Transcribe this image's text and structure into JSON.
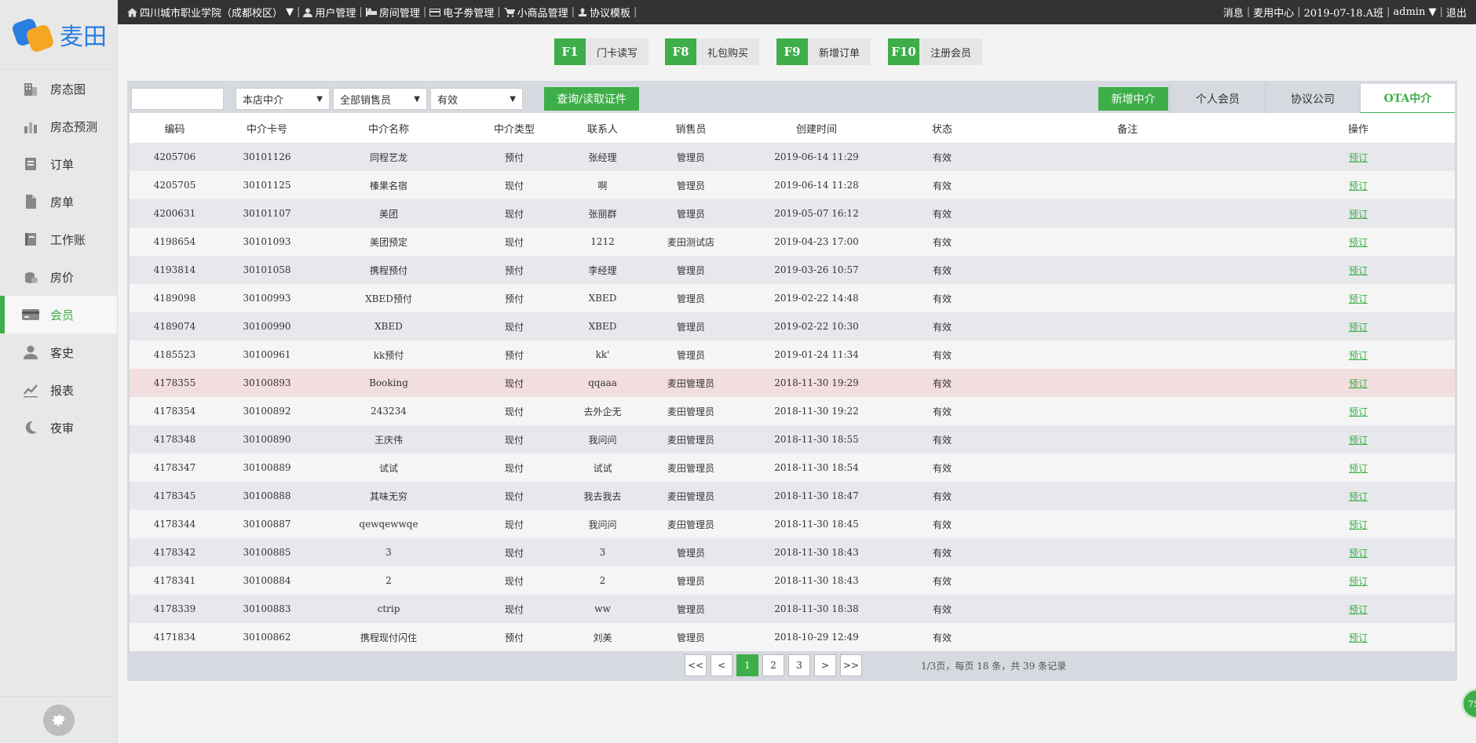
{
  "brand": {
    "logo_text": "麦田"
  },
  "sidebar": {
    "items": [
      {
        "label": "房态图",
        "icon": "building-icon",
        "active": false
      },
      {
        "label": "房态预测",
        "icon": "bar-chart-icon",
        "active": false
      },
      {
        "label": "订单",
        "icon": "order-icon",
        "active": false
      },
      {
        "label": "房单",
        "icon": "document-icon",
        "active": false
      },
      {
        "label": "工作账",
        "icon": "ledger-icon",
        "active": false
      },
      {
        "label": "房价",
        "icon": "coins-icon",
        "active": false
      },
      {
        "label": "会员",
        "icon": "member-card-icon",
        "active": true
      },
      {
        "label": "客史",
        "icon": "user-icon",
        "active": false
      },
      {
        "label": "报表",
        "icon": "report-chart-icon",
        "active": false
      },
      {
        "label": "夜审",
        "icon": "moon-icon",
        "active": false
      }
    ]
  },
  "topbar": {
    "hotel": "四川城市职业学院（成都校区）",
    "hotel_caret": "▼",
    "menu": [
      "用户管理",
      "房间管理",
      "电子劵管理",
      "小商品管理",
      "协议模板"
    ],
    "right": [
      "消息",
      "麦用中心",
      "2019-07-18.A班",
      "admin ▼",
      "退出"
    ]
  },
  "hotkeys": [
    {
      "key": "F1",
      "label": "门卡读写"
    },
    {
      "key": "F8",
      "label": "礼包购买"
    },
    {
      "key": "F9",
      "label": "新增订单"
    },
    {
      "key": "F10",
      "label": "注册会员"
    }
  ],
  "filters": {
    "search_value": "",
    "store_select": "本店中介",
    "sales_select": "全部销售员",
    "status_select": "有效",
    "query_button": "查询/读取证件"
  },
  "tabs": {
    "add_button": "新增中介",
    "items": [
      {
        "label": "个人会员",
        "active": false
      },
      {
        "label": "协议公司",
        "active": false
      },
      {
        "label": "OTA中介",
        "active": true
      }
    ]
  },
  "table": {
    "columns": [
      "编码",
      "中介卡号",
      "中介名称",
      "中介类型",
      "联系人",
      "销售员",
      "创建时间",
      "状态",
      "备注",
      "操作"
    ],
    "action_label": "预订",
    "rows": [
      [
        "4205706",
        "30101126",
        "同程艺龙",
        "预付",
        "张经理",
        "管理员",
        "2019-06-14 11:29",
        "有效",
        ""
      ],
      [
        "4205705",
        "30101125",
        "榛果名宿",
        "现付",
        "啊",
        "管理员",
        "2019-06-14 11:28",
        "有效",
        ""
      ],
      [
        "4200631",
        "30101107",
        "美团",
        "现付",
        "张丽群",
        "管理员",
        "2019-05-07 16:12",
        "有效",
        ""
      ],
      [
        "4198654",
        "30101093",
        "美团预定",
        "现付",
        "1212",
        "麦田测试店",
        "2019-04-23 17:00",
        "有效",
        ""
      ],
      [
        "4193814",
        "30101058",
        "携程预付",
        "预付",
        "李经理",
        "管理员",
        "2019-03-26 10:57",
        "有效",
        ""
      ],
      [
        "4189098",
        "30100993",
        "XBED预付",
        "预付",
        "XBED",
        "管理员",
        "2019-02-22 14:48",
        "有效",
        ""
      ],
      [
        "4189074",
        "30100990",
        "XBED",
        "现付",
        "XBED",
        "管理员",
        "2019-02-22 10:30",
        "有效",
        ""
      ],
      [
        "4185523",
        "30100961",
        "kk预付",
        "预付",
        "kk'",
        "管理员",
        "2019-01-24 11:34",
        "有效",
        ""
      ],
      [
        "4178355",
        "30100893",
        "Booking",
        "现付",
        "qqaaa",
        "麦田管理员",
        "2018-11-30 19:29",
        "有效",
        ""
      ],
      [
        "4178354",
        "30100892",
        "243234",
        "现付",
        "去外企无",
        "麦田管理员",
        "2018-11-30 19:22",
        "有效",
        ""
      ],
      [
        "4178348",
        "30100890",
        "王庆伟",
        "现付",
        "我问问",
        "麦田管理员",
        "2018-11-30 18:55",
        "有效",
        ""
      ],
      [
        "4178347",
        "30100889",
        "试试",
        "现付",
        "试试",
        "麦田管理员",
        "2018-11-30 18:54",
        "有效",
        ""
      ],
      [
        "4178345",
        "30100888",
        "其味无穷",
        "现付",
        "我去我去",
        "麦田管理员",
        "2018-11-30 18:47",
        "有效",
        ""
      ],
      [
        "4178344",
        "30100887",
        "qewqewwqe",
        "现付",
        "我问问",
        "麦田管理员",
        "2018-11-30 18:45",
        "有效",
        ""
      ],
      [
        "4178342",
        "30100885",
        "3",
        "现付",
        "3",
        "管理员",
        "2018-11-30 18:43",
        "有效",
        ""
      ],
      [
        "4178341",
        "30100884",
        "2",
        "现付",
        "2",
        "管理员",
        "2018-11-30 18:43",
        "有效",
        ""
      ],
      [
        "4178339",
        "30100883",
        "ctrip",
        "现付",
        "ww",
        "管理员",
        "2018-11-30 18:38",
        "有效",
        ""
      ],
      [
        "4171834",
        "30100862",
        "携程现付闪住",
        "预付",
        "刘美",
        "管理员",
        "2018-10-29 12:49",
        "有效",
        ""
      ]
    ],
    "highlight_row_index": 8
  },
  "pager": {
    "first": "<<",
    "prev": "<",
    "pages": [
      "1",
      "2",
      "3"
    ],
    "current_page": "1",
    "next": ">",
    "last": ">>",
    "info": "1/3页，每页 18 条，共 39 条记录"
  },
  "float_badge": "75",
  "colors": {
    "accent": "#3dae49",
    "topbar": "#333333",
    "brand_blue": "#2a7ee0",
    "brand_orange": "#f5a623"
  }
}
